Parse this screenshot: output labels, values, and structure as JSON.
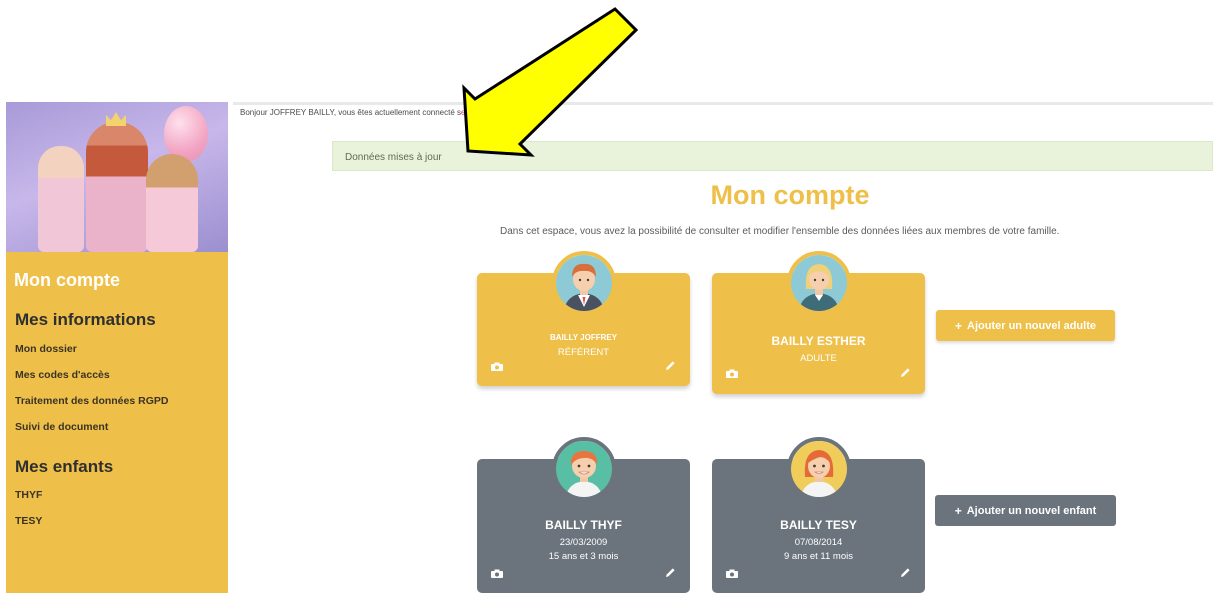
{
  "greeting": {
    "text": "Bonjour JOFFREY BAILLY, vous êtes actuellement connecté s",
    "link": "e"
  },
  "alert": {
    "message": "Données mises à jour"
  },
  "main": {
    "title": "Mon compte",
    "intro": "Dans cet espace, vous avez la possibilité de consulter et modifier l'ensemble des données liées aux membres de votre famille."
  },
  "sidebar": {
    "title": "Mon compte",
    "info_heading": "Mes informations",
    "info_items": [
      "Mon dossier",
      "Mes codes d'accès",
      "Traitement des données RGPD",
      "Suivi de document"
    ],
    "children_heading": "Mes enfants",
    "children_items": [
      "THYF",
      "TESY"
    ]
  },
  "adults": [
    {
      "name": "BAILLY JOFFREY",
      "role": "RÉFÉRENT"
    },
    {
      "name": "BAILLY ESTHER",
      "role": "ADULTE"
    }
  ],
  "children": [
    {
      "name": "BAILLY THYF",
      "birthdate": "23/03/2009",
      "age": "15 ans et 3 mois"
    },
    {
      "name": "BAILLY TESY",
      "birthdate": "07/08/2014",
      "age": "9 ans et 11 mois"
    }
  ],
  "buttons": {
    "add_adult": "Ajouter un nouvel adulte",
    "add_child": "Ajouter un nouvel enfant"
  },
  "icons": {
    "camera": "camera-icon",
    "pencil": "pencil-icon",
    "plus": "+"
  },
  "colors": {
    "accent": "#eebf49",
    "card_child": "#6b737c",
    "alert_bg": "#e9f3dc",
    "annotation_arrow": "#ffff00"
  }
}
